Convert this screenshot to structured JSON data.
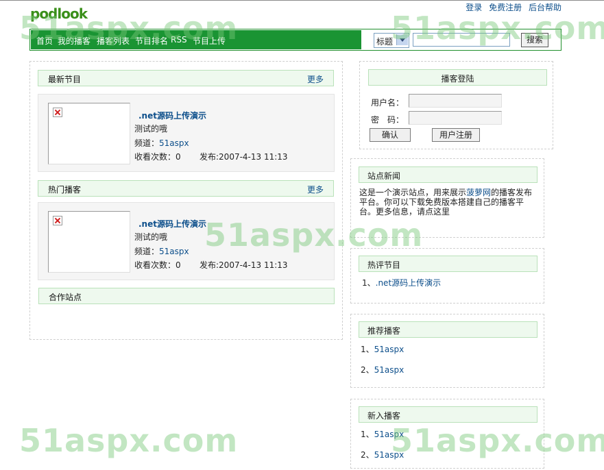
{
  "header": {
    "logo": "podlook",
    "links": [
      "登录",
      "免费注册",
      "后台帮助"
    ]
  },
  "nav": {
    "items": [
      "首页",
      "我的播客",
      "播客列表",
      "节目排名",
      "RSS",
      "节目上传"
    ],
    "search_select": "标题",
    "search_button": "搜索"
  },
  "left": {
    "latest": {
      "title": "最新节目",
      "more": "更多",
      "item": {
        "title": ".net源码上传演示",
        "desc": "测试的哦",
        "channel_label": "频道：",
        "channel": "51aspx",
        "views": "收看次数：0",
        "published": "发布:2007-4-13 11:13"
      }
    },
    "hot": {
      "title": "热门播客",
      "more": "更多",
      "item": {
        "title": ".net源码上传演示",
        "desc": "测试的哦",
        "channel_label": "频道：",
        "channel": "51aspx",
        "views": "收看次数：0",
        "published": "发布:2007-4-13 11:13"
      }
    },
    "partners": {
      "title": "合作站点"
    }
  },
  "right": {
    "login": {
      "title": "播客登陆",
      "user_label": "用户名：",
      "pass_label": "密　码：",
      "confirm": "确认",
      "register": "用户注册"
    },
    "news": {
      "title": "站点新闻",
      "text_pre": "这是一个演示站点，用来展示",
      "link": "菠萝网",
      "text_post": "的播客发布平台。你可以下载免费版本搭建自己的播客平台。更多信息，请点这里"
    },
    "hotreview": {
      "title": "热评节目",
      "items": [
        {
          "num": "1、",
          "label": ".net源码上传演示"
        }
      ]
    },
    "recommend": {
      "title": "推荐播客",
      "items": [
        {
          "num": "1、",
          "label": "51aspx"
        },
        {
          "num": "2、",
          "label": "51aspx"
        }
      ]
    },
    "newpod": {
      "title": "新入播客",
      "items": [
        {
          "num": "1、",
          "label": "51aspx"
        },
        {
          "num": "2、",
          "label": "51aspx"
        }
      ]
    }
  },
  "watermarks": [
    "51aspx.com",
    "51aspx.com",
    "51aspx.com",
    "51aspx.com",
    "51aspx.com"
  ],
  "colors": {
    "nav_green": "#1a9433",
    "link_blue": "#0d4f8b",
    "bar_bg": "#eef9ee"
  }
}
